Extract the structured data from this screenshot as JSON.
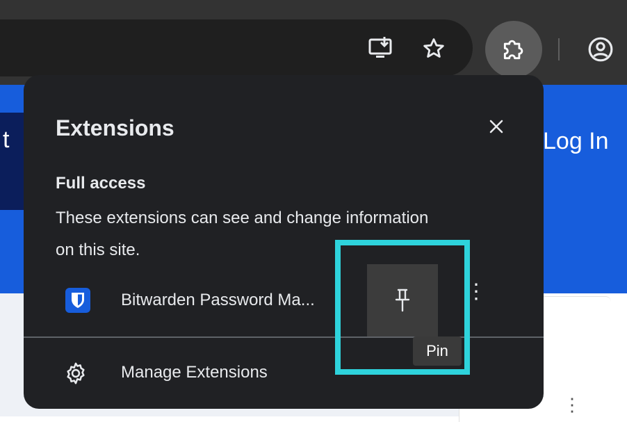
{
  "toolbar": {
    "icons": [
      "install-app-icon",
      "bookmark-star-icon",
      "extensions-puzzle-icon",
      "profile-icon"
    ]
  },
  "page": {
    "left_text": "t",
    "login": "Log In"
  },
  "popup": {
    "title": "Extensions",
    "section_heading": "Full access",
    "section_desc": "These extensions can see and change information on this site.",
    "extension": {
      "name": "Bitwarden Password Ma...",
      "icon": "bitwarden-shield-icon"
    },
    "manage_label": "Manage Extensions",
    "tooltip": "Pin"
  },
  "colors": {
    "toolbar_bg": "#333333",
    "popup_bg": "#202124",
    "page_accent": "#175ddc",
    "highlight": "#2ed3dc"
  }
}
